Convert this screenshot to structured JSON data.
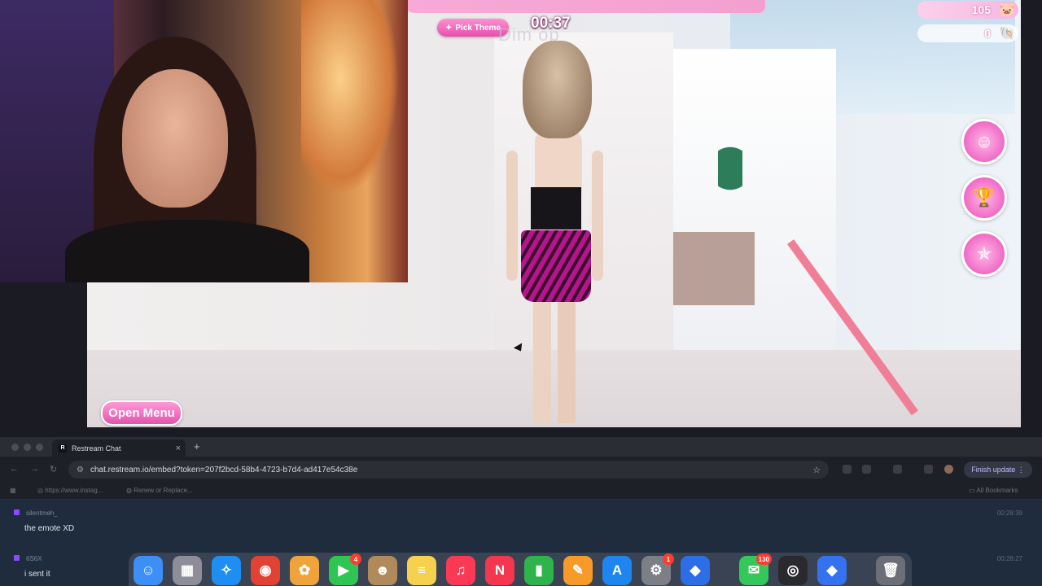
{
  "game": {
    "theme_button": "Pick Theme",
    "timer": "00:37",
    "ghost_text": "Dim  op",
    "coins": "105",
    "gems": "0",
    "open_menu": "Open Menu",
    "side_buttons": [
      "avatar-icon",
      "trophy-icon",
      "pose-icon"
    ],
    "colors": {
      "accent_pink": "#e253ae",
      "rail_pink": "#f07e96"
    }
  },
  "browser": {
    "tab_title": "Restream Chat",
    "tab_favicon": "R",
    "url": "chat.restream.io/embed?token=207f2bcd-58b4-4723-b7d4-ad417e54c38e",
    "finish_update": "Finish update",
    "bookmarks": [
      "https://www.instag...",
      "Renew or Replace..."
    ],
    "all_bookmarks": "All Bookmarks"
  },
  "chat": {
    "messages": [
      {
        "user": "silentmeh_",
        "text": "the emote XD",
        "time": "00:28:39"
      },
      {
        "user": "6S6X",
        "text": "i sent it",
        "time": "00:28:27"
      }
    ]
  },
  "dock": {
    "apps": [
      {
        "name": "finder-icon",
        "glyph": "☺",
        "color": "#3d8ef6"
      },
      {
        "name": "launchpad-icon",
        "glyph": "▦",
        "color": "#8e8e9a"
      },
      {
        "name": "safari-icon",
        "glyph": "✧",
        "color": "#1e8ef2"
      },
      {
        "name": "chrome-icon",
        "glyph": "◉",
        "color": "#e34133"
      },
      {
        "name": "photos-icon",
        "glyph": "✿",
        "color": "#f1a33b"
      },
      {
        "name": "facetime-icon",
        "glyph": "▶",
        "color": "#2fc552",
        "badge": "4"
      },
      {
        "name": "contacts-icon",
        "glyph": "☻",
        "color": "#b08a5a"
      },
      {
        "name": "notes-icon",
        "glyph": "≡",
        "color": "#f5d14e"
      },
      {
        "name": "music-icon",
        "glyph": "♫",
        "color": "#fa3a55"
      },
      {
        "name": "news-icon",
        "glyph": "N",
        "color": "#f5364f"
      },
      {
        "name": "numbers-icon",
        "glyph": "▮",
        "color": "#2fb44b"
      },
      {
        "name": "pages-icon",
        "glyph": "✎",
        "color": "#f79a2a"
      },
      {
        "name": "app-store-icon",
        "glyph": "A",
        "color": "#1f86f0"
      },
      {
        "name": "system-settings-icon",
        "glyph": "⚙",
        "color": "#7c7f86",
        "badge": "1"
      },
      {
        "name": "roblox-icon",
        "glyph": "◆",
        "color": "#2d6de6"
      },
      {
        "name": "messages-icon",
        "glyph": "✉",
        "color": "#34c759",
        "badge": "130"
      },
      {
        "name": "obs-icon",
        "glyph": "◎",
        "color": "#2a2a2e"
      },
      {
        "name": "roblox-studio-icon",
        "glyph": "◆",
        "color": "#3472f0"
      },
      {
        "name": "trash-icon",
        "glyph": "🗑",
        "color": "#6c6f77"
      }
    ]
  }
}
